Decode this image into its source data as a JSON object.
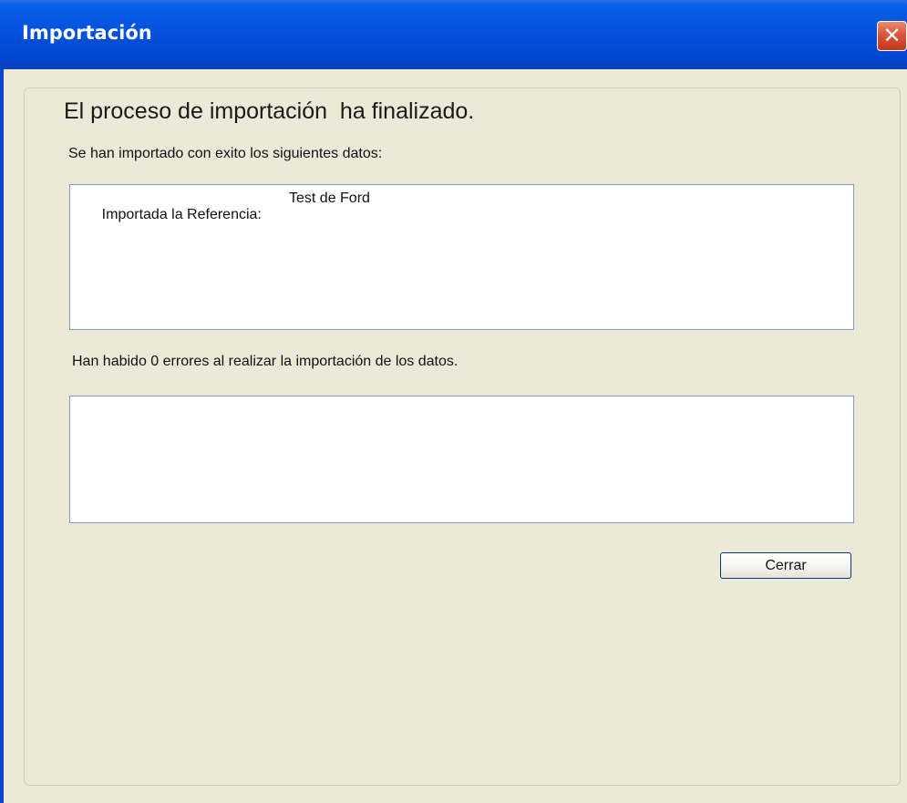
{
  "window": {
    "title": "Importación",
    "close_glyph": "✕"
  },
  "content": {
    "heading": "El proceso de importación  ha finalizado.",
    "success_label": "Se han importado con exito los siguientes datos:",
    "imported_items": [
      {
        "label": "Importada la Referencia:",
        "value": "Test de Ford"
      }
    ],
    "errors_label": "Han habido 0 errores al realizar la importación de los datos.",
    "error_items": []
  },
  "buttons": {
    "close_label": "Cerrar"
  },
  "colors": {
    "titlebar": "#0350dc",
    "window_bg": "#ece9d8",
    "close_button": "#d9553a",
    "listbox_border": "#7f9db9"
  },
  "icons": {
    "close": "close-icon"
  }
}
